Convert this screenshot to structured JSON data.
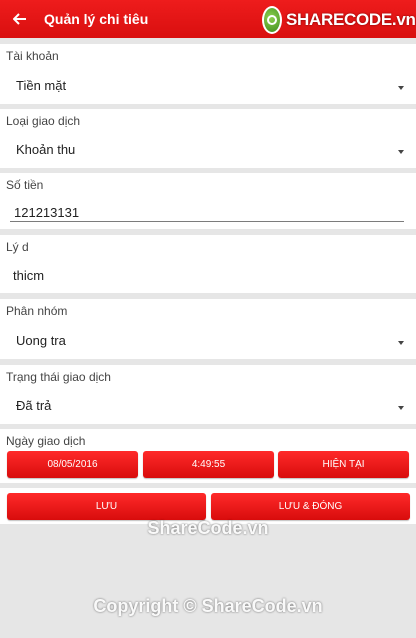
{
  "header": {
    "title": "Quản lý chi tiêu",
    "brand": "SHARECODE.vn"
  },
  "account": {
    "label": "Tài khoản",
    "value": "Tiền mặt"
  },
  "transaction_type": {
    "label": "Loại giao dịch",
    "value": "Khoản thu"
  },
  "amount": {
    "label": "Số tiền",
    "value": "121213131"
  },
  "reason": {
    "label": "Lý d",
    "value": "thicm"
  },
  "group": {
    "label": "Phân nhóm",
    "value": "Uong tra"
  },
  "status": {
    "label": "Trạng thái giao dịch",
    "value": "Đã trả"
  },
  "date": {
    "label": "Ngày giao dịch",
    "date_value": "08/05/2016",
    "time_value": "4:49:55",
    "now_label": "HIỆN TẠI"
  },
  "actions": {
    "save_label": "LƯU",
    "save_close_label": "LƯU & ĐÓNG"
  },
  "watermark": {
    "line1": "ShareCode.vn",
    "line2": "Copyright © ShareCode.vn"
  },
  "colors": {
    "primary": "#e31414",
    "background": "#e6e6e6"
  }
}
